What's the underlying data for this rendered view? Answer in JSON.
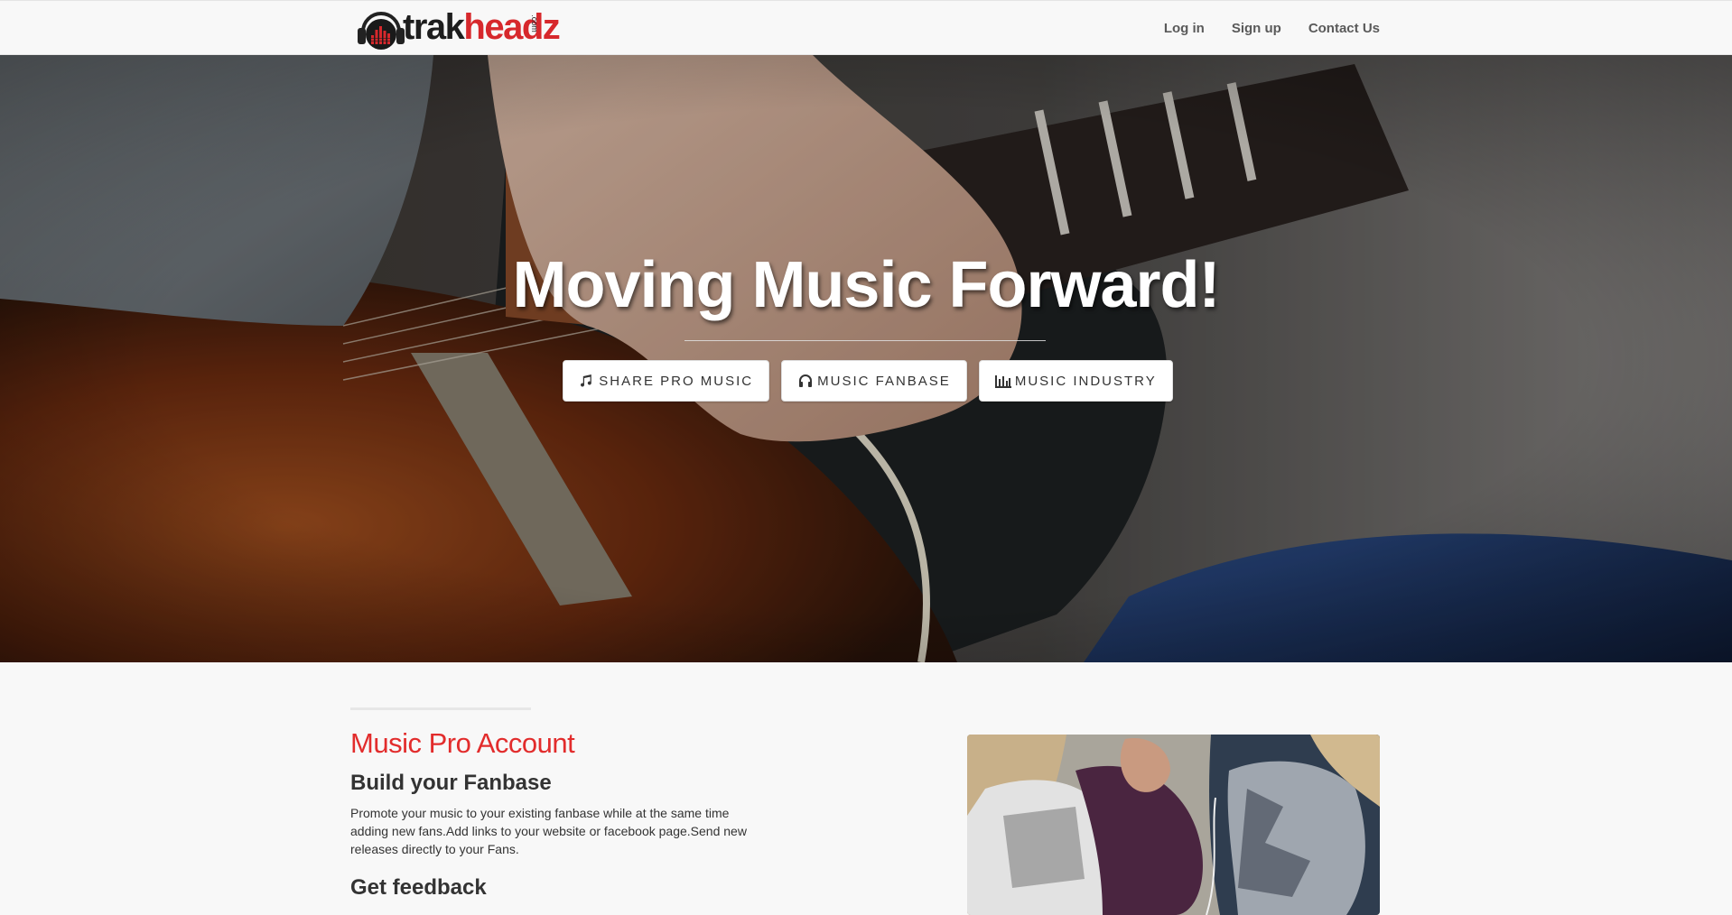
{
  "brand": {
    "name_part1": "trak",
    "name_part2": "headz",
    "suffix": ".com",
    "accent_color": "#d7282c"
  },
  "nav": {
    "links": [
      {
        "label": "Log in"
      },
      {
        "label": "Sign up"
      },
      {
        "label": "Contact Us"
      }
    ]
  },
  "hero": {
    "title": "Moving Music Forward!",
    "buttons": [
      {
        "label": "SHARE PRO MUSIC",
        "icon": "music-note-icon"
      },
      {
        "label": "MUSIC FANBASE",
        "icon": "headphones-icon"
      },
      {
        "label": "MUSIC INDUSTRY",
        "icon": "bar-chart-icon"
      }
    ]
  },
  "feature": {
    "heading": "Music Pro Account",
    "subheading_1": "Build your Fanbase",
    "body_1": "Promote your music to your existing fanbase while at the same time adding new fans.Add links to your website or facebook page.Send new releases directly to your Fans.",
    "subheading_2": "Get feedback",
    "heading_color": "#e22c2c"
  }
}
